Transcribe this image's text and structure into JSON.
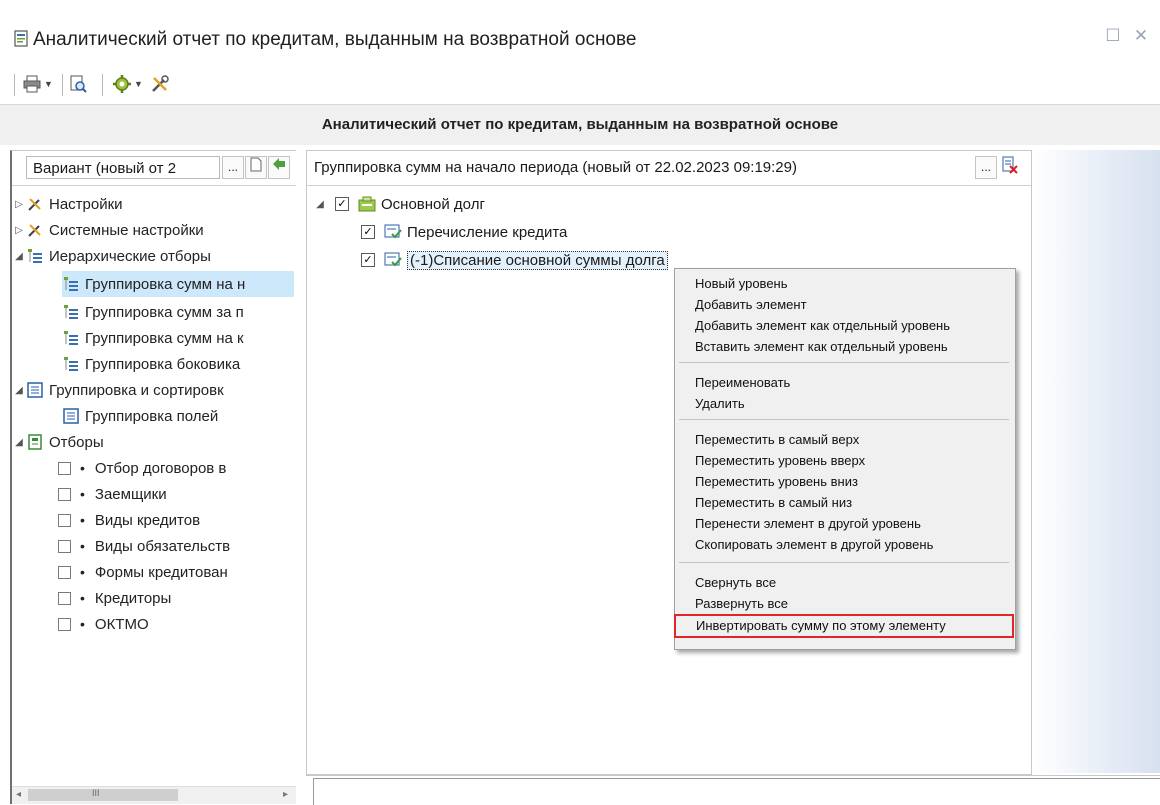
{
  "window": {
    "title": "Аналитический отчет по кредитам, выданным на возвратной основе",
    "controls": {
      "maximize": "☐",
      "close": "✕"
    }
  },
  "toolbar": {
    "items": [
      {
        "icon": "print-icon"
      },
      {
        "icon": "preview-icon"
      },
      {
        "icon": "settings-gear-icon"
      },
      {
        "icon": "tools-icon"
      }
    ]
  },
  "report": {
    "title": "Аналитический отчет по кредитам, выданным на возвратной основе"
  },
  "left_panel": {
    "variant": "Вариант (новый от 2",
    "variant_btn": "...",
    "tree": [
      {
        "label": "Настройки"
      },
      {
        "label": "Системные настройки"
      },
      {
        "label": "Иерархические отборы"
      },
      {
        "label": "Группировка сумм на н"
      },
      {
        "label": "Группировка сумм за п"
      },
      {
        "label": "Группировка сумм на к"
      },
      {
        "label": "Группировка боковика"
      },
      {
        "label": "Группировка и сортировк"
      },
      {
        "label": "Группировка полей"
      },
      {
        "label": "Отборы"
      },
      {
        "label": "Отбор договоров в"
      },
      {
        "label": "Заемщики"
      },
      {
        "label": "Виды кредитов"
      },
      {
        "label": "Виды обязательств"
      },
      {
        "label": "Формы кредитован"
      },
      {
        "label": "Кредиторы"
      },
      {
        "label": "ОКТМО"
      }
    ],
    "scroll_grip": "III"
  },
  "main_panel": {
    "title": "Группировка сумм на начало периода (новый от 22.02.2023 09:19:29)",
    "more_btn": "...",
    "tree": [
      {
        "label": "Основной долг"
      },
      {
        "label": "Перечисление кредита"
      },
      {
        "label": "(-1)Списание основной суммы долга"
      }
    ]
  },
  "context_menu": {
    "groups": [
      [
        "Новый уровень",
        "Добавить элемент",
        "Добавить элемент как отдельный уровень",
        "Вставить элемент как отдельный уровень"
      ],
      [
        "Переименовать",
        "Удалить"
      ],
      [
        "Переместить в самый верх",
        "Переместить уровень вверх",
        "Переместить уровень вниз",
        "Переместить в самый низ",
        "Перенести элемент в другой уровень",
        "Скопировать элемент в другой уровень"
      ],
      [
        "Свернуть все",
        "Развернуть все",
        "Инвертировать сумму по этому элементу"
      ]
    ]
  },
  "colors": {
    "highlight_border": "#e0252b",
    "selection": "#cde8fb",
    "menu_bg": "#f0f0f0"
  }
}
